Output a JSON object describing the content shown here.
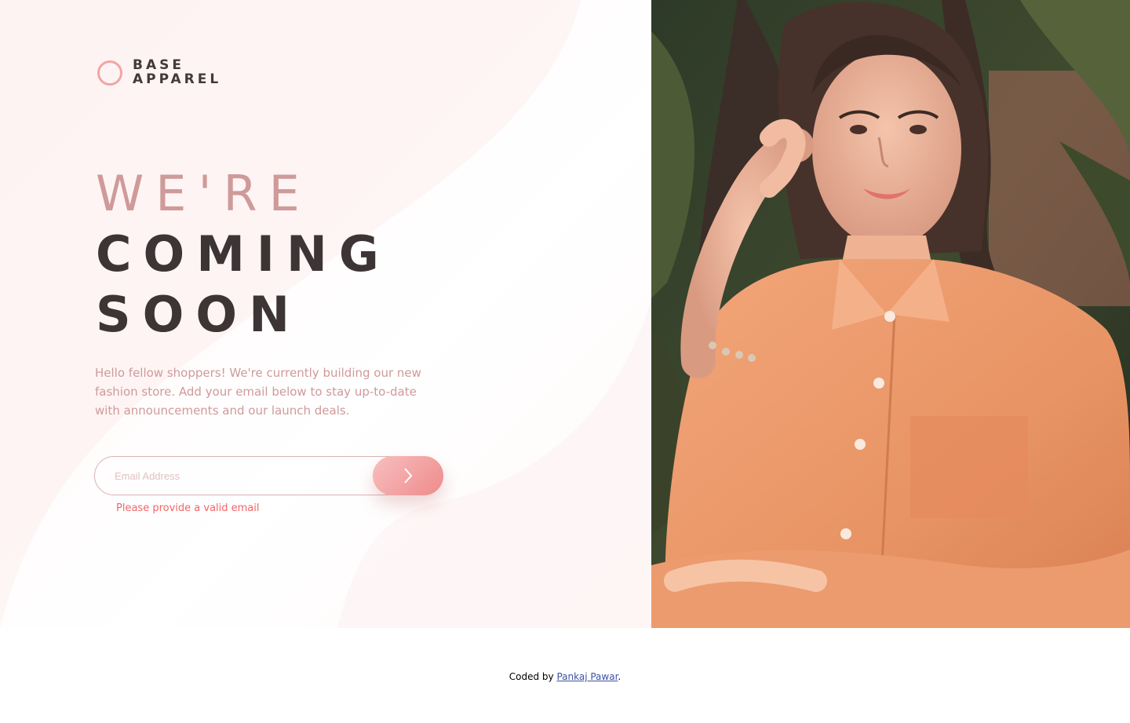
{
  "brand": {
    "line1": "BASE",
    "line2": "APPAREL"
  },
  "headline": {
    "light": "WE'RE",
    "dark_line1": "COMING",
    "dark_line2": "SOON"
  },
  "description": "Hello fellow shoppers! We're currently building our new fashion store. Add your email below to stay up-to-date with announcements and our launch deals.",
  "form": {
    "email_placeholder": "Email Address",
    "email_value": "",
    "submit_icon": "chevron-right-icon",
    "error": "Please provide a valid email"
  },
  "hero": {
    "image": "woman-in-orange-shirt-photo"
  },
  "footer": {
    "prefix": "Coded by ",
    "author": "Pankaj Pawar",
    "suffix": "."
  },
  "colors": {
    "accent": "#f1a5a5",
    "text_dark": "#423a3a",
    "text_muted": "#cf9a9a",
    "error": "#f16666",
    "button_start": "#f8bfbf",
    "button_end": "#ee8b8b",
    "link": "#3e52a3"
  }
}
